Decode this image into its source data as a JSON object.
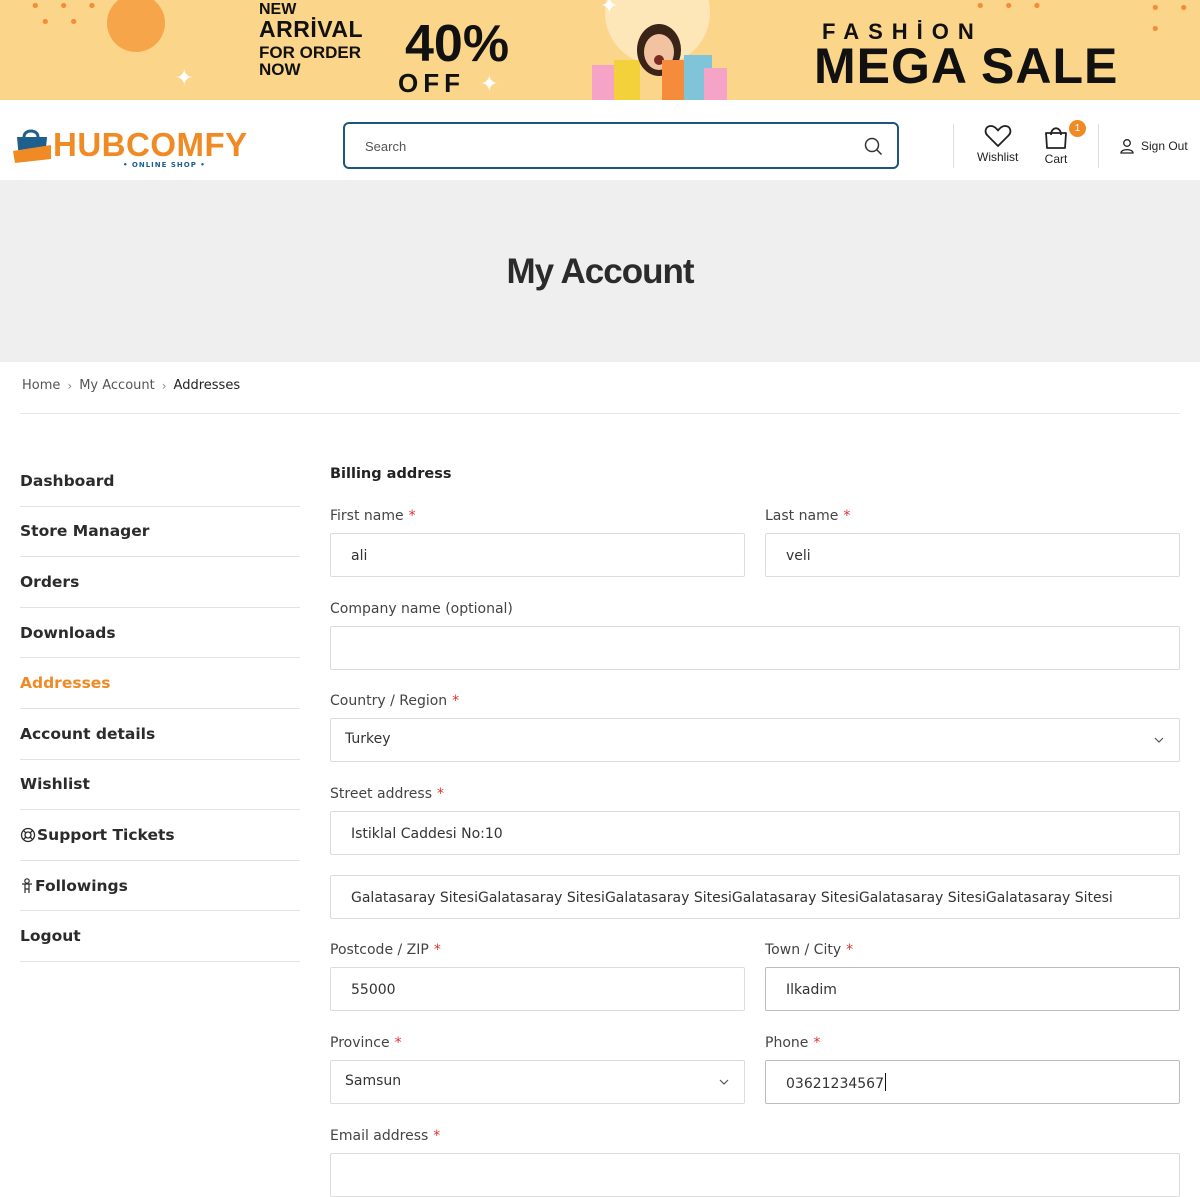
{
  "banner": {
    "new_line1": "NEW",
    "new_line2": "ARRİVAL",
    "new_line3": "FOR ORDER",
    "new_line4": "NOW",
    "discount": "40%",
    "off": "OFF",
    "fashion": "FASHİON",
    "mega_sale": "MEGA SALE",
    "colors": {
      "background": "#fbd58a",
      "accent": "#f7a54a"
    }
  },
  "header": {
    "logo_text": "HUBCOMFY",
    "logo_sub": "• ONLINE SHOP •",
    "search_placeholder": "Search",
    "wishlist_label": "Wishlist",
    "cart_label": "Cart",
    "cart_count": "1",
    "signout_label": "Sign Out",
    "colors": {
      "brand": "#f08a24",
      "search_border": "#1d5679"
    }
  },
  "page_title": "My Account",
  "breadcrumb": {
    "items": [
      "Home",
      "My Account",
      "Addresses"
    ]
  },
  "sidebar": {
    "items": [
      {
        "label": "Dashboard",
        "icon": ""
      },
      {
        "label": "Store Manager",
        "icon": ""
      },
      {
        "label": "Orders",
        "icon": ""
      },
      {
        "label": "Downloads",
        "icon": ""
      },
      {
        "label": "Addresses",
        "icon": "",
        "active": true
      },
      {
        "label": "Account details",
        "icon": ""
      },
      {
        "label": "Wishlist",
        "icon": ""
      },
      {
        "label": "Support Tickets",
        "icon": "lifebuoy-icon"
      },
      {
        "label": "Followings",
        "icon": "child-icon"
      },
      {
        "label": "Logout",
        "icon": ""
      }
    ],
    "active_color": "#f08a24"
  },
  "form": {
    "heading": "Billing address",
    "first_name": {
      "label": "First name",
      "value": "ali"
    },
    "last_name": {
      "label": "Last name",
      "value": "veli"
    },
    "company": {
      "label": "Company name (optional)",
      "value": ""
    },
    "country": {
      "label": "Country / Region",
      "value": "Turkey"
    },
    "street": {
      "label": "Street address",
      "value": "Istiklal Caddesi No:10"
    },
    "street2": {
      "value": "Galatasaray SitesiGalatasaray SitesiGalatasaray SitesiGalatasaray SitesiGalatasaray SitesiGalatasaray Sitesi"
    },
    "postcode": {
      "label": "Postcode / ZIP",
      "value": "55000"
    },
    "city": {
      "label": "Town / City",
      "value": "Ilkadim"
    },
    "province": {
      "label": "Province",
      "value": "Samsun"
    },
    "phone": {
      "label": "Phone",
      "value": "03621234567"
    },
    "email": {
      "label": "Email address"
    },
    "required_mark": "*"
  }
}
